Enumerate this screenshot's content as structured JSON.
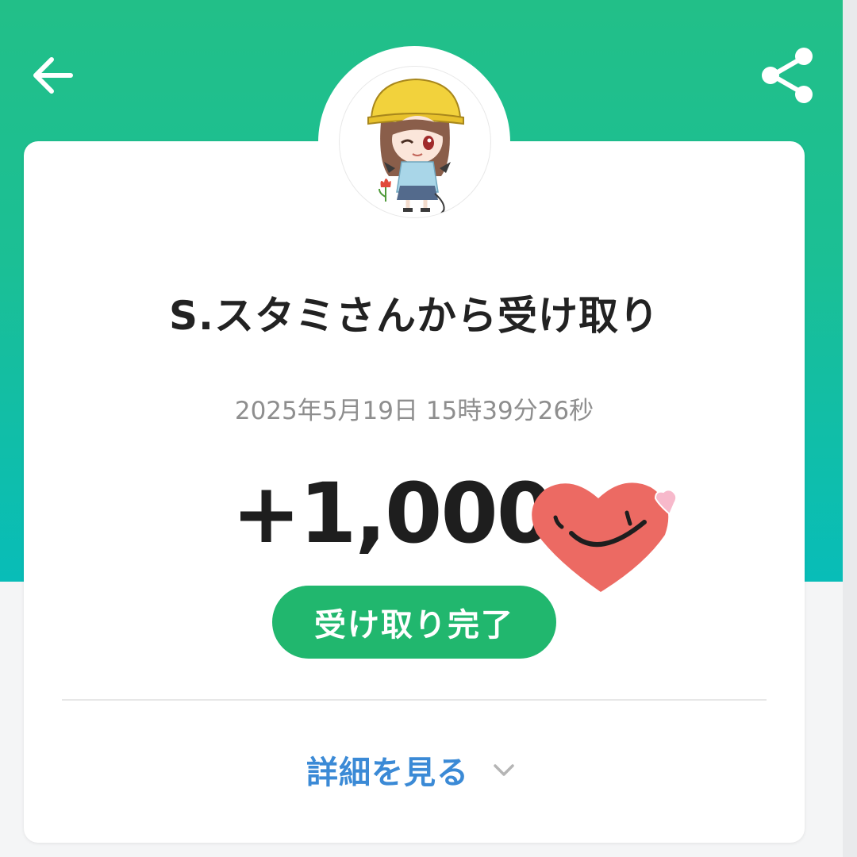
{
  "header": {
    "back_icon": "arrow-left-icon",
    "share_icon": "share-icon",
    "gradient_colors": [
      "#22bf88",
      "#08bdb8"
    ]
  },
  "transaction": {
    "title": "S.スタミさんから受け取り",
    "timestamp": "2025年5月19日 15時39分26秒",
    "amount": "+1,000",
    "status": "受け取り完了"
  },
  "details": {
    "label": "詳細を見る",
    "icon": "chevron-down-icon"
  },
  "colors": {
    "status_badge": "#21b76e",
    "link": "#3b8ad6",
    "heart": "#ec6a63"
  }
}
